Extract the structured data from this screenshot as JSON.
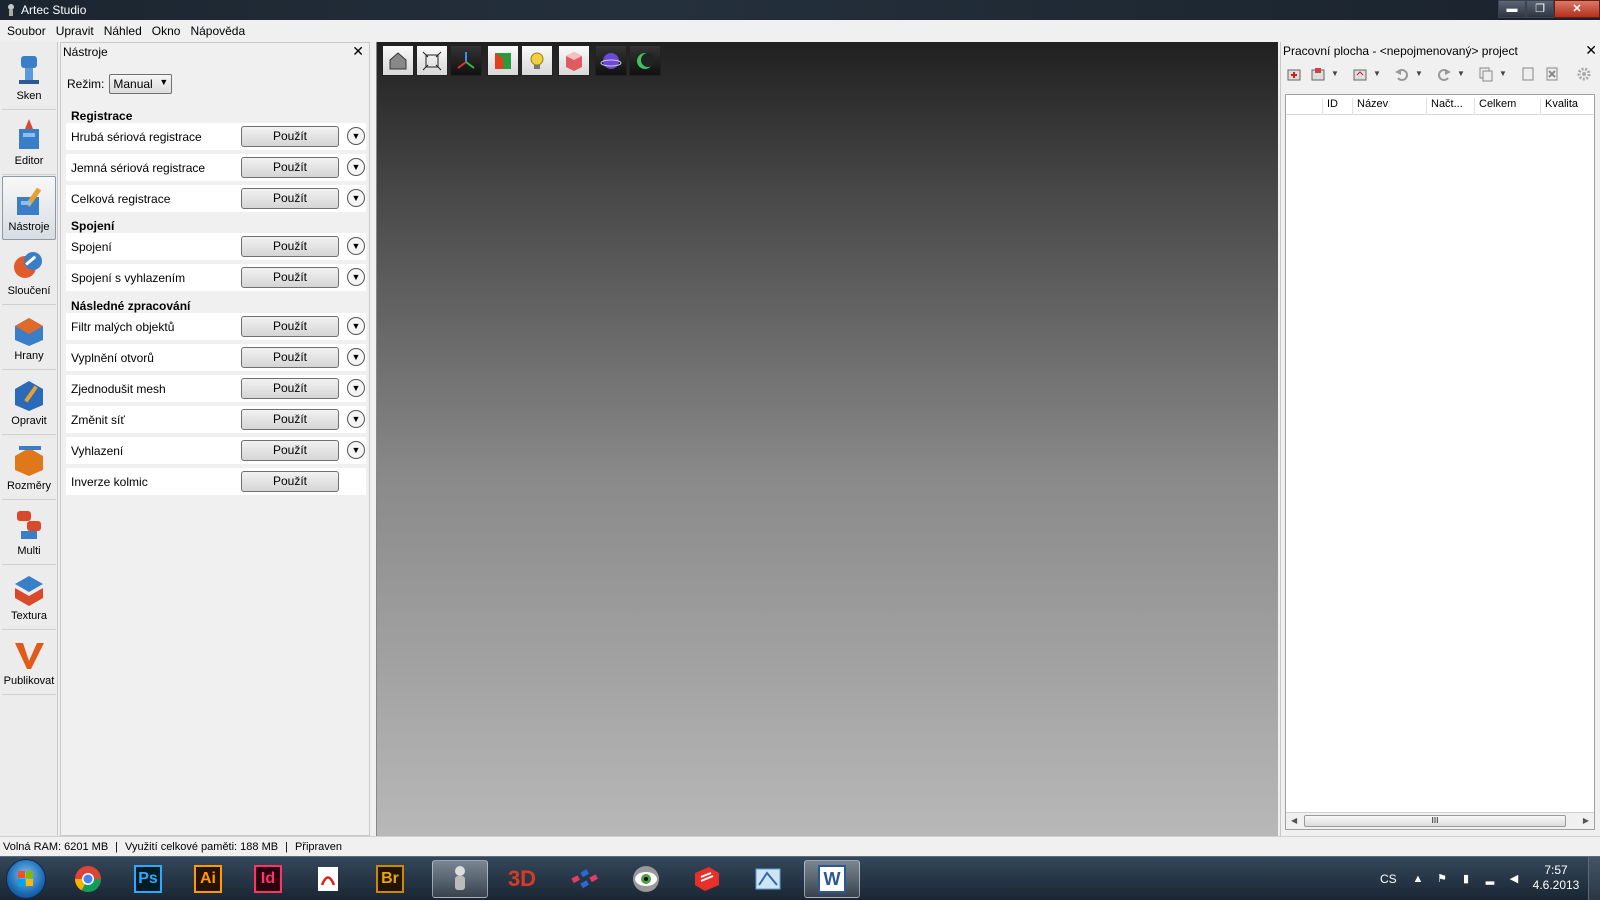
{
  "window": {
    "title": "Artec Studio",
    "min_label": "▬",
    "max_label": "❐",
    "close_label": "✕"
  },
  "menubar": {
    "items": [
      "Soubor",
      "Upravit",
      "Náhled",
      "Okno",
      "Nápověda"
    ]
  },
  "modebar": {
    "items": [
      {
        "label": "Sken",
        "icon": "scanner-icon"
      },
      {
        "label": "Editor",
        "icon": "editor-icon"
      },
      {
        "label": "Nástroje",
        "icon": "tools-icon",
        "active": true
      },
      {
        "label": "Sloučení",
        "icon": "merge-icon"
      },
      {
        "label": "Hrany",
        "icon": "edges-icon"
      },
      {
        "label": "Opravit",
        "icon": "repair-icon"
      },
      {
        "label": "Rozměry",
        "icon": "measure-icon"
      },
      {
        "label": "Multi",
        "icon": "multi-icon"
      },
      {
        "label": "Textura",
        "icon": "texture-icon"
      },
      {
        "label": "Publikovat",
        "icon": "publish-icon"
      }
    ]
  },
  "tools": {
    "title": "Nástroje",
    "close_label": "✕",
    "mode_label": "Režim:",
    "mode_value": "Manual",
    "apply_label": "Použít",
    "sections": [
      {
        "title": "Registrace",
        "rows": [
          {
            "name": "Hrubá sériová registrace",
            "expand": true
          },
          {
            "name": "Jemná sériová registrace",
            "expand": true
          },
          {
            "name": "Celková registrace",
            "expand": true
          }
        ]
      },
      {
        "title": "Spojení",
        "rows": [
          {
            "name": "Spojení",
            "expand": true
          },
          {
            "name": "Spojení s vyhlazením",
            "expand": true
          }
        ]
      },
      {
        "title": "Následné zpracování",
        "rows": [
          {
            "name": "Filtr malých objektů",
            "expand": true
          },
          {
            "name": "Vyplnění otvorů",
            "expand": true
          },
          {
            "name": "Zjednodušit mesh",
            "expand": true
          },
          {
            "name": "Změnit síť",
            "expand": true
          },
          {
            "name": "Vyhlazení",
            "expand": true
          },
          {
            "name": "Inverze kolmic",
            "expand": false
          }
        ]
      }
    ]
  },
  "viewport": {
    "toolbar": [
      "home-view-icon",
      "fit-view-icon",
      "axes-icon",
      "box-view-icon",
      "light-icon",
      "cube-render-icon",
      "sphere-icon",
      "moon-icon"
    ]
  },
  "workspace": {
    "title": "Pracovní plocha - <nepojmenovaný> project",
    "close_label": "✕",
    "columns": [
      "ID",
      "Název",
      "Načt...",
      "Celkem",
      "Kvalita"
    ],
    "scroll_grip": "III"
  },
  "status": {
    "free_ram": "Volná RAM: 6201 MB",
    "mem_usage": "Využití celkové paměti: 188 MB",
    "state": "Připraven"
  },
  "taskbar": {
    "apps": [
      {
        "name": "chrome",
        "glyph": "",
        "color": "#4285f4"
      },
      {
        "name": "photoshop",
        "glyph": "Ps",
        "color": "#31a8ff"
      },
      {
        "name": "illustrator",
        "glyph": "Ai",
        "color": "#ff9a00"
      },
      {
        "name": "indesign",
        "glyph": "Id",
        "color": "#ff3366"
      },
      {
        "name": "acrobat",
        "glyph": "",
        "color": "#d8261c"
      },
      {
        "name": "bridge",
        "glyph": "Br",
        "color": "#c88a00"
      },
      {
        "name": "artec-studio",
        "glyph": "",
        "color": "#bbbbbb",
        "active": true
      },
      {
        "name": "3d-app",
        "glyph": "3D",
        "color": "#d83b24"
      },
      {
        "name": "molecule-app",
        "glyph": "",
        "color": "#e23d6a"
      },
      {
        "name": "eye-app",
        "glyph": "",
        "color": "#999999"
      },
      {
        "name": "sketchup",
        "glyph": "",
        "color": "#e8302a"
      },
      {
        "name": "3d-viewer",
        "glyph": "",
        "color": "#5aa0d8"
      },
      {
        "name": "word",
        "glyph": "W",
        "color": "#2b5797",
        "active": true
      }
    ],
    "lang": "CS",
    "time": "7:57",
    "date": "4.6.2013"
  }
}
